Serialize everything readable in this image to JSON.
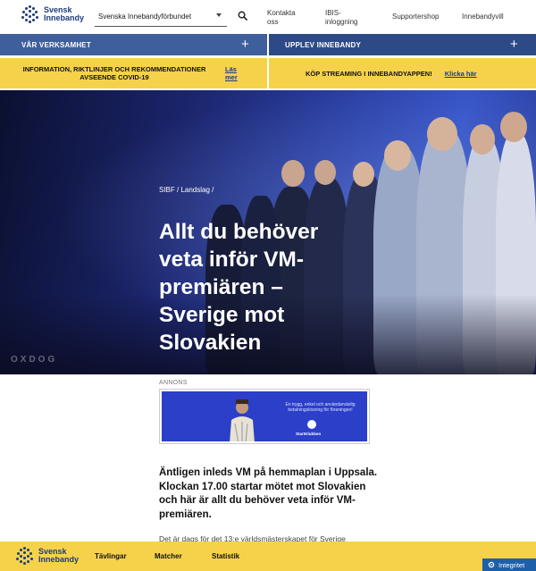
{
  "header": {
    "logo_line1": "Svensk",
    "logo_line2": "Innebandy",
    "org_select_value": "Svenska Innebandyförbundet",
    "nav": [
      {
        "line1": "Kontakta",
        "line2": "oss"
      },
      {
        "line1": "IBIS-",
        "line2": "inloggning"
      },
      {
        "line1": "Supportershop",
        "line2": ""
      },
      {
        "line1": "Innebandyvill",
        "line2": ""
      }
    ]
  },
  "bars": {
    "left_label": "VÅR VERKSAMHET",
    "right_label": "UPPLEV INNEBANDY",
    "plus": "+"
  },
  "notices": {
    "left_text": "INFORMATION, RIKTLINJER OCH REKOMMENDATIONER AVSEENDE COVID-19",
    "left_link_line1": "Läs",
    "left_link_line2": "mer",
    "right_text": "KÖP STREAMING I INNEBANDYAPPEN!",
    "right_link": "Klicka här"
  },
  "hero": {
    "breadcrumb": "SIBF / Landslag /",
    "title": "Allt du behöver veta inför VM-premiären – Sverige mot Slovakien",
    "watermark": "OXDOG"
  },
  "ad": {
    "label": "ANNONS",
    "text": "En trygg, enkel och användarvänlig betalningslösning för föreningen!",
    "brand": "StartKlubben"
  },
  "article": {
    "lead": "Äntligen inleds VM på hemmaplan i Uppsala. Klockan 17.00 startar mötet mot Slovakien och här är allt du behöver veta inför VM-premiären.",
    "body_start": "Det är dags för det 13:e världsmästerskapet för Sverige"
  },
  "footer": {
    "logo_line1": "Svensk",
    "logo_line2": "Innebandy",
    "links": [
      "Tävlingar",
      "Matcher",
      "Statistik"
    ],
    "integrity_button": "Integritet"
  },
  "colors": {
    "brand_blue": "#1d3b7a",
    "bar_blue": "#3f5e9c",
    "notice_yellow": "#f6d24b",
    "link_blue": "#1b3a8c"
  }
}
